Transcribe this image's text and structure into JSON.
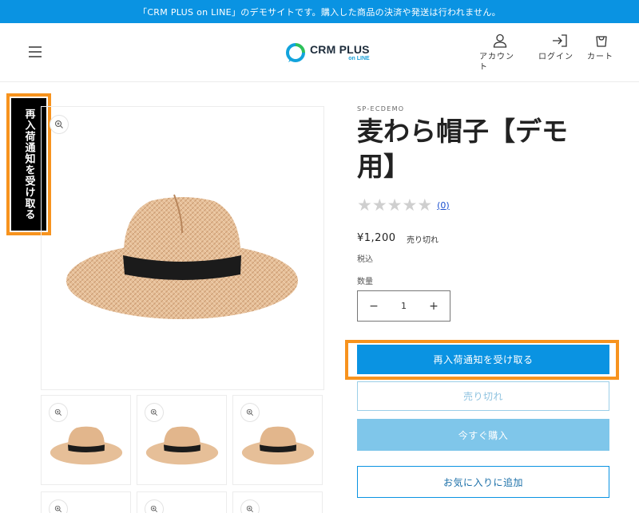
{
  "announcement": "「CRM PLUS on LINE」のデモサイトです。購入した商品の決済や発送は行われません。",
  "header": {
    "logo_main": "CRM PLUS",
    "logo_sub": "on LINE",
    "account_label": "アカウント",
    "login_label": "ログイン",
    "cart_label": "カート"
  },
  "side_tab": "再入荷通知を受け取る",
  "product": {
    "vendor": "SP-ECDEMO",
    "title": "麦わら帽子【デモ用】",
    "review_count": "(0)",
    "rating": 0,
    "price": "¥1,200",
    "soldout_badge": "売り切れ",
    "tax_note": "税込",
    "quantity_label": "数量",
    "quantity_value": "1",
    "quantity_minus": "−",
    "quantity_plus": "+"
  },
  "buttons": {
    "notify": "再入荷通知を受け取る",
    "soldout": "売り切れ",
    "buy_now": "今すぐ購入",
    "favorite": "お気に入りに追加"
  },
  "colors": {
    "accent": "#0a93e2",
    "highlight": "#f7931e",
    "buy_now_disabled": "#7fc6ea"
  },
  "icons": {
    "menu": "hamburger-menu-icon",
    "account": "user-icon",
    "login": "login-icon",
    "cart": "bag-icon",
    "zoom": "zoom-in-icon",
    "star": "star-icon"
  }
}
